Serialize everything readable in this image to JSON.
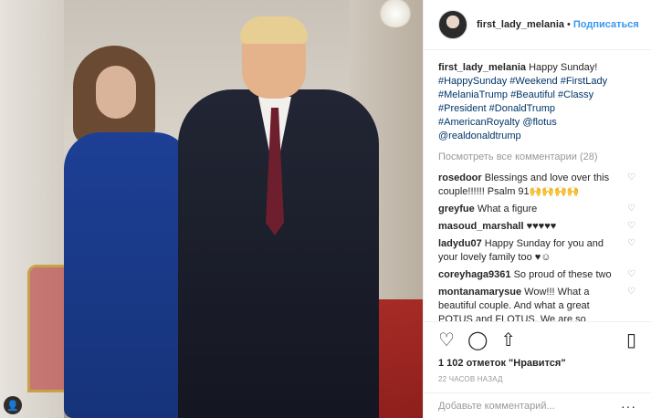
{
  "header": {
    "username": "first_lady_melania",
    "separator": "•",
    "follow_label": "Подписаться"
  },
  "caption": {
    "username": "first_lady_melania",
    "text": "Happy Sunday!",
    "tags": [
      "#HappySunday #Weekend #FirstLady",
      "#MelaniaTrump #Beautiful #Classy",
      "#President #DonaldTrump",
      "#AmericanRoyalty @flotus",
      "@realdonaldtrump"
    ]
  },
  "view_all_label": "Посмотреть все комментарии (28)",
  "comments": [
    {
      "username": "rosedoor",
      "text": "Blessings and love over this couple!!!!!! Psalm 91🙌🙌🙌🙌"
    },
    {
      "username": "greyfue",
      "text": "What a figure"
    },
    {
      "username": "masoud_marshall",
      "text": "♥♥♥♥♥"
    },
    {
      "username": "ladydu07",
      "text": "Happy Sunday for you and your lovely family too ♥☺"
    },
    {
      "username": "coreyhaga9361",
      "text": "So proud of these two"
    },
    {
      "username": "montanamarysue",
      "text": "Wow!!! What a beautiful couple. And what a great POTUS and FLOTUS. We are so thankful for you both. ♥"
    }
  ],
  "icons": {
    "like": "♡",
    "comment": "◯",
    "share": "⇧",
    "bookmark": "▯",
    "comment_like": "♡",
    "more": "···",
    "user_tag": "👤"
  },
  "likes_text": "1 102 отметок \"Нравится\"",
  "time_text": "22 ЧАСОВ НАЗАД",
  "add_comment_placeholder": "Добавьте комментарий..."
}
